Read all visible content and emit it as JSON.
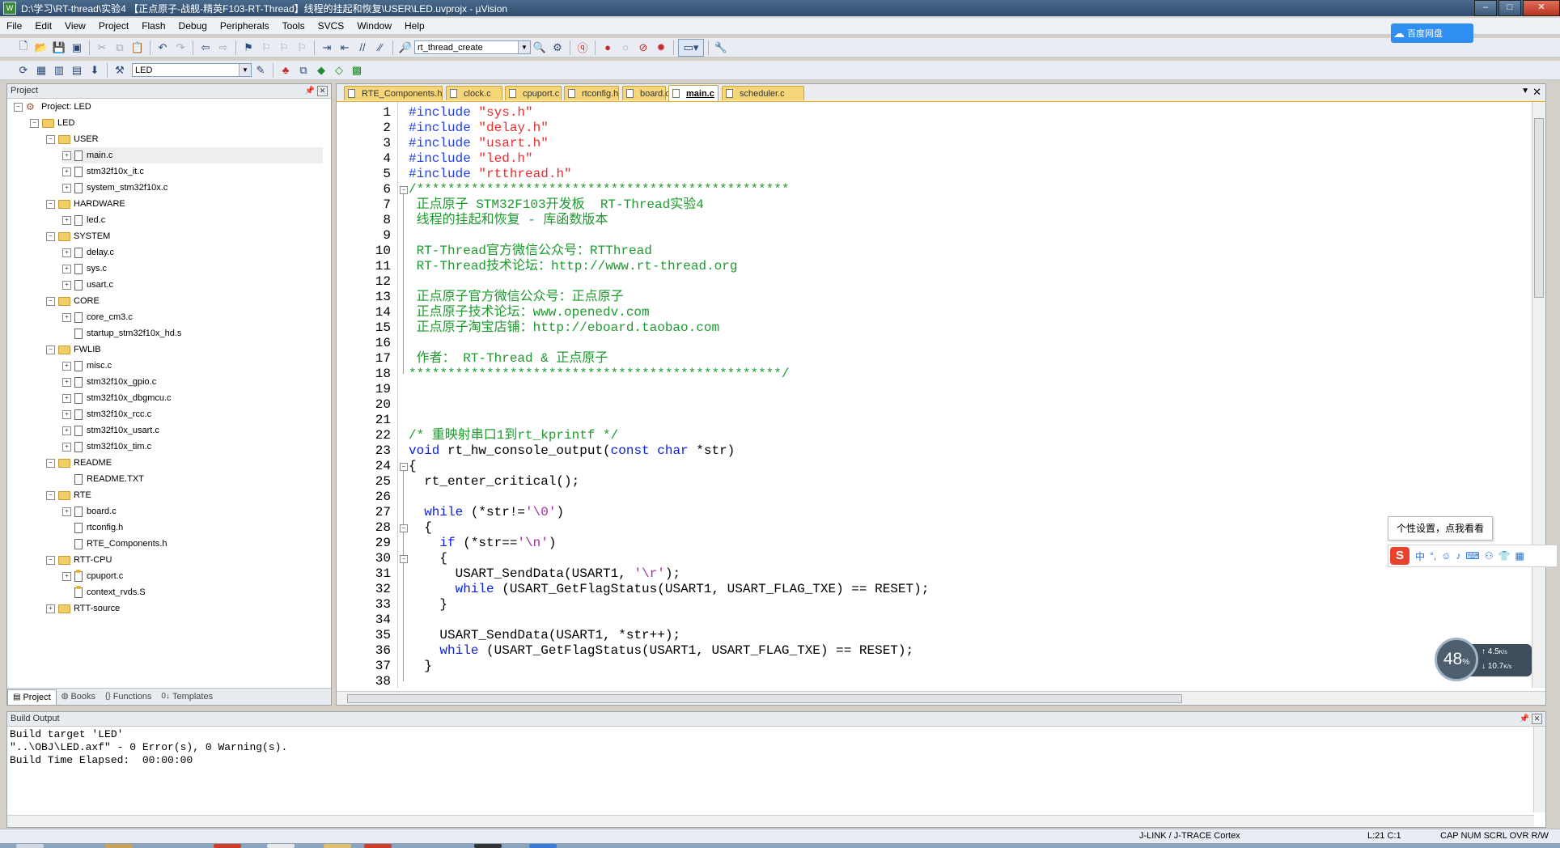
{
  "window": {
    "title": "D:\\学习\\RT-thread\\实验4 【正点原子-战舰-精英F103-RT-Thread】线程的挂起和恢复\\USER\\LED.uvprojx - µVision",
    "app_icon": "W",
    "buttons": {
      "minimize": "–",
      "maximize": "□",
      "close": "✕"
    }
  },
  "menu": [
    "File",
    "Edit",
    "View",
    "Project",
    "Flash",
    "Debug",
    "Peripherals",
    "Tools",
    "SVCS",
    "Window",
    "Help"
  ],
  "toolbar1": {
    "find_combo": "rt_thread_create"
  },
  "toolbar2": {
    "target_combo": "LED"
  },
  "cloud_badge": {
    "text": "百度网盘"
  },
  "project_pane": {
    "title": "Project",
    "tree": [
      {
        "label": "Project: LED",
        "level": 0,
        "type": "project",
        "exp": "−"
      },
      {
        "label": "LED",
        "level": 1,
        "type": "folder",
        "exp": "−"
      },
      {
        "label": "USER",
        "level": 2,
        "type": "folder",
        "exp": "−"
      },
      {
        "label": "main.c",
        "level": 3,
        "type": "file",
        "exp": "+",
        "selected": true
      },
      {
        "label": "stm32f10x_it.c",
        "level": 3,
        "type": "file",
        "exp": "+"
      },
      {
        "label": "system_stm32f10x.c",
        "level": 3,
        "type": "file",
        "exp": "+"
      },
      {
        "label": "HARDWARE",
        "level": 2,
        "type": "folder",
        "exp": "−"
      },
      {
        "label": "led.c",
        "level": 3,
        "type": "file",
        "exp": "+"
      },
      {
        "label": "SYSTEM",
        "level": 2,
        "type": "folder",
        "exp": "−"
      },
      {
        "label": "delay.c",
        "level": 3,
        "type": "file",
        "exp": "+"
      },
      {
        "label": "sys.c",
        "level": 3,
        "type": "file",
        "exp": "+"
      },
      {
        "label": "usart.c",
        "level": 3,
        "type": "file",
        "exp": "+"
      },
      {
        "label": "CORE",
        "level": 2,
        "type": "folder",
        "exp": "−"
      },
      {
        "label": "core_cm3.c",
        "level": 3,
        "type": "file",
        "exp": "+"
      },
      {
        "label": "startup_stm32f10x_hd.s",
        "level": 3,
        "type": "file",
        "exp": ""
      },
      {
        "label": "FWLIB",
        "level": 2,
        "type": "folder",
        "exp": "−"
      },
      {
        "label": "misc.c",
        "level": 3,
        "type": "file",
        "exp": "+"
      },
      {
        "label": "stm32f10x_gpio.c",
        "level": 3,
        "type": "file",
        "exp": "+"
      },
      {
        "label": "stm32f10x_dbgmcu.c",
        "level": 3,
        "type": "file",
        "exp": "+"
      },
      {
        "label": "stm32f10x_rcc.c",
        "level": 3,
        "type": "file",
        "exp": "+"
      },
      {
        "label": "stm32f10x_usart.c",
        "level": 3,
        "type": "file",
        "exp": "+"
      },
      {
        "label": "stm32f10x_tim.c",
        "level": 3,
        "type": "file",
        "exp": "+"
      },
      {
        "label": "README",
        "level": 2,
        "type": "folder",
        "exp": "−"
      },
      {
        "label": "README.TXT",
        "level": 3,
        "type": "file",
        "exp": ""
      },
      {
        "label": "RTE",
        "level": 2,
        "type": "folder",
        "exp": "−"
      },
      {
        "label": "board.c",
        "level": 3,
        "type": "file",
        "exp": "+"
      },
      {
        "label": "rtconfig.h",
        "level": 3,
        "type": "file",
        "exp": ""
      },
      {
        "label": "RTE_Components.h",
        "level": 3,
        "type": "file",
        "exp": ""
      },
      {
        "label": "RTT-CPU",
        "level": 2,
        "type": "folder",
        "exp": "−"
      },
      {
        "label": "cpuport.c",
        "level": 3,
        "type": "filekey",
        "exp": "+"
      },
      {
        "label": "context_rvds.S",
        "level": 3,
        "type": "filekey",
        "exp": ""
      },
      {
        "label": "RTT-source",
        "level": 2,
        "type": "folder",
        "exp": "+"
      }
    ],
    "tabs": [
      {
        "icon": "▤",
        "label": "Project",
        "active": true
      },
      {
        "icon": "◍",
        "label": "Books"
      },
      {
        "icon": "{}",
        "label": "Functions"
      },
      {
        "icon": "0↓",
        "label": "Templates"
      }
    ]
  },
  "editor": {
    "tabs": [
      {
        "label": "RTE_Components.h"
      },
      {
        "label": "clock.c"
      },
      {
        "label": "cpuport.c"
      },
      {
        "label": "rtconfig.h"
      },
      {
        "label": "board.c"
      },
      {
        "label": "main.c",
        "active": true
      },
      {
        "label": "scheduler.c"
      }
    ],
    "lines": [
      [
        [
          "pre",
          "#include "
        ],
        [
          "str",
          "\"sys.h\""
        ]
      ],
      [
        [
          "pre",
          "#include "
        ],
        [
          "str",
          "\"delay.h\""
        ]
      ],
      [
        [
          "pre",
          "#include "
        ],
        [
          "str",
          "\"usart.h\""
        ]
      ],
      [
        [
          "pre",
          "#include "
        ],
        [
          "str",
          "\"led.h\""
        ]
      ],
      [
        [
          "pre",
          "#include "
        ],
        [
          "str",
          "\"rtthread.h\""
        ]
      ],
      [
        [
          "com",
          "/************************************************"
        ]
      ],
      [
        [
          "com",
          " 正点原子 STM32F103开发板  RT-Thread实验4"
        ]
      ],
      [
        [
          "com",
          " 线程的挂起和恢复 - 库函数版本"
        ]
      ],
      [],
      [
        [
          "com",
          " RT-Thread官方微信公众号：RTThread"
        ]
      ],
      [
        [
          "com",
          " RT-Thread技术论坛：http://www.rt-thread.org"
        ]
      ],
      [],
      [
        [
          "com",
          " 正点原子官方微信公众号：正点原子"
        ]
      ],
      [
        [
          "com",
          " 正点原子技术论坛：www.openedv.com"
        ]
      ],
      [
        [
          "com",
          " 正点原子淘宝店铺：http://eboard.taobao.com"
        ]
      ],
      [],
      [
        [
          "com",
          " 作者： RT-Thread & 正点原子"
        ]
      ],
      [
        [
          "com",
          "************************************************/"
        ]
      ],
      [],
      [],
      [],
      [
        [
          "com",
          "/* 重映射串口1到rt_kprintf */"
        ]
      ],
      [
        [
          "kw",
          "void"
        ],
        [
          "txt",
          " rt_hw_console_output("
        ],
        [
          "kw",
          "const char"
        ],
        [
          "txt",
          " *str)"
        ]
      ],
      [
        [
          "txt",
          "{"
        ]
      ],
      [
        [
          "txt",
          "  rt_enter_critical();"
        ]
      ],
      [],
      [
        [
          "txt",
          "  "
        ],
        [
          "kw",
          "while"
        ],
        [
          "txt",
          " (*str!="
        ],
        [
          "chr",
          "'\\0'"
        ],
        [
          "txt",
          ")"
        ]
      ],
      [
        [
          "txt",
          "  {"
        ]
      ],
      [
        [
          "txt",
          "    "
        ],
        [
          "kw",
          "if"
        ],
        [
          "txt",
          " (*str=="
        ],
        [
          "chr",
          "'\\n'"
        ],
        [
          "txt",
          ")"
        ]
      ],
      [
        [
          "txt",
          "    {"
        ]
      ],
      [
        [
          "txt",
          "      USART_SendData(USART1, "
        ],
        [
          "chr",
          "'\\r'"
        ],
        [
          "txt",
          ");"
        ]
      ],
      [
        [
          "txt",
          "      "
        ],
        [
          "kw",
          "while"
        ],
        [
          "txt",
          " (USART_GetFlagStatus(USART1, USART_FLAG_TXE) == RESET);"
        ]
      ],
      [
        [
          "txt",
          "    }"
        ]
      ],
      [],
      [
        [
          "txt",
          "    USART_SendData(USART1, *str++);"
        ]
      ],
      [
        [
          "txt",
          "    "
        ],
        [
          "kw",
          "while"
        ],
        [
          "txt",
          " (USART_GetFlagStatus(USART1, USART_FLAG_TXE) == RESET);"
        ]
      ],
      [
        [
          "txt",
          "  }"
        ]
      ],
      []
    ],
    "line_numbers": [
      "1",
      "2",
      "3",
      "4",
      "5",
      "6",
      "7",
      "8",
      "9",
      "10",
      "11",
      "12",
      "13",
      "14",
      "15",
      "16",
      "17",
      "18",
      "19",
      "20",
      "21",
      "22",
      "23",
      "24",
      "25",
      "26",
      "27",
      "28",
      "29",
      "30",
      "31",
      "32",
      "33",
      "34",
      "35",
      "36",
      "37",
      "38"
    ]
  },
  "ime": {
    "tooltip": "个性设置，点我看看",
    "logo": "S",
    "items": [
      "中",
      "°,",
      "☺",
      "♪",
      "⌨",
      "⚇",
      "👕",
      "▦"
    ]
  },
  "net_monitor": {
    "percent": "48",
    "percent_unit": "%",
    "up": "4.5",
    "up_unit": "K/s",
    "down": "10.7",
    "down_unit": "K/s"
  },
  "build_output": {
    "title": "Build Output",
    "text": "Build target 'LED'\n\"..\\OBJ\\LED.axf\" - 0 Error(s), 0 Warning(s).\nBuild Time Elapsed:  00:00:00"
  },
  "status_bar": {
    "debugger": "J-LINK / J-TRACE Cortex",
    "position": "L:21 C:1",
    "indicators": "CAP  NUM  SCRL  OVR  R/W"
  }
}
